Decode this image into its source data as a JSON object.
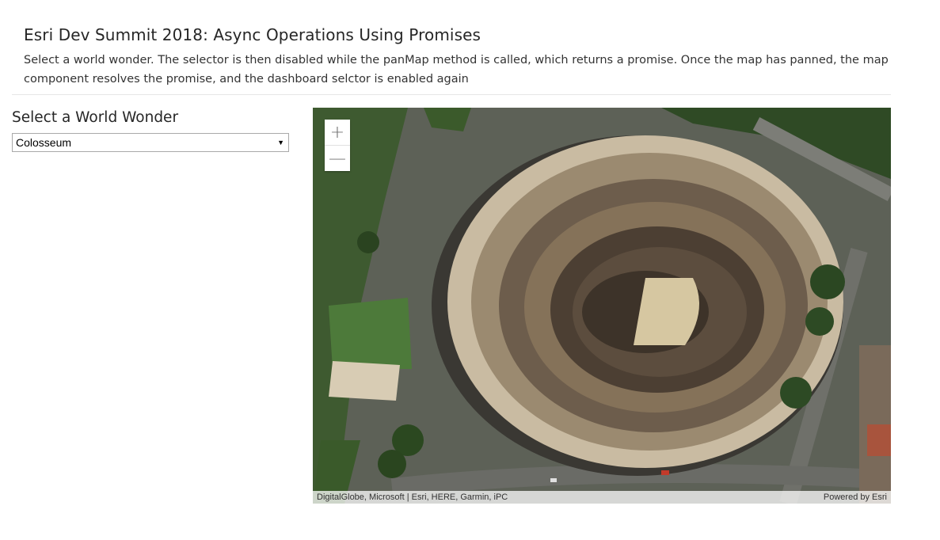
{
  "header": {
    "title": "Esri Dev Summit 2018: Async Operations Using Promises",
    "description": "Select a world wonder. The selector is then disabled while the panMap method is called, which returns a promise. Once the map has panned, the map component resolves the promise, and the dashboard selctor is enabled again"
  },
  "selector": {
    "heading": "Select a World Wonder",
    "selected": "Colosseum"
  },
  "map": {
    "zoom_in_label": "+",
    "zoom_out_label": "—",
    "attribution": "DigitalGlobe, Microsoft | Esri, HERE, Garmin, iPC",
    "powered_by": "Powered by Esri"
  }
}
